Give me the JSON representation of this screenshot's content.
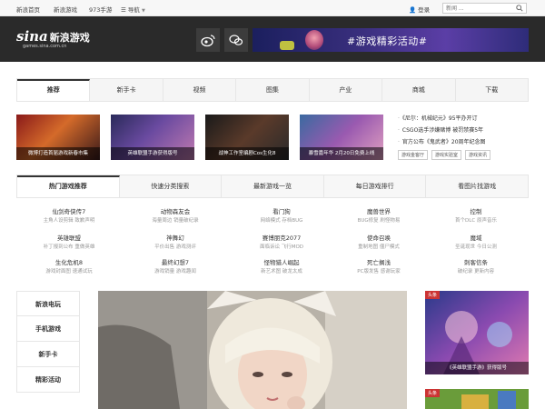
{
  "topbar": {
    "links": [
      "新浪首页",
      "新浪游戏",
      "973手游"
    ],
    "nav_label": "导航",
    "login_label": "登录",
    "search_placeholder": "新闻 ..."
  },
  "header": {
    "logo_brand": "sina",
    "logo_cn": "新浪游戏",
    "logo_url": "games.sina.com.cn",
    "banner_text": "#游戏精彩活动#"
  },
  "tabs1": [
    "推荐",
    "新手卡",
    "视频",
    "图集",
    "产业",
    "商城",
    "下载"
  ],
  "thumbs": [
    "微博打造首届游戏新春市集",
    "英雄联盟手游获得版号",
    "战神工作室编剧Cos生化8",
    "暴雪嘉年华 2月20日免费上线"
  ],
  "news": {
    "items": [
      "《尼尔：机械纪元》95平办开订",
      "CSGO选手涉嫌赌博 被罚禁赛5年",
      "官方公布《鬼武者》20周年纪念图"
    ],
    "chips": [
      "游戏金客厅",
      "游戏实验室",
      "游戏资讯"
    ]
  },
  "tabs2": [
    "热门游戏推荐",
    "快速分类搜索",
    "最新游戏一览",
    "每日游戏排行",
    "看图片找游戏"
  ],
  "games": [
    {
      "name": "仙剑奇侠传7",
      "subs": [
        "主角人设剪辑",
        "致歉声明"
      ]
    },
    {
      "name": "动物森友会",
      "subs": [
        "海量周边",
        "销量破纪录"
      ]
    },
    {
      "name": "看门狗",
      "subs": [
        "网络模式",
        "存档BUG"
      ]
    },
    {
      "name": "魔兽世界",
      "subs": [
        "BUG修复",
        "刷怪物易"
      ]
    },
    {
      "name": "控制",
      "subs": [
        "首个DLC",
        "原声音乐"
      ]
    },
    {
      "name": "英雄联盟",
      "subs": [
        "补丁报到公布",
        "重做英雄"
      ]
    },
    {
      "name": "神舞幻",
      "subs": [
        "平价出售",
        "游戏测评"
      ]
    },
    {
      "name": "赛博朋克2077",
      "subs": [
        "面临诉讼",
        "飞行MOD"
      ]
    },
    {
      "name": "使命召唤",
      "subs": [
        "重制地图",
        "僵尸模式"
      ]
    },
    {
      "name": "魔域",
      "subs": [
        "圣诞现世",
        "今日公测"
      ]
    },
    {
      "name": "生化危机8",
      "subs": [
        "游戏封面图",
        "速通试玩"
      ]
    },
    {
      "name": "最终幻想7",
      "subs": [
        "游戏销量",
        "游戏趣闻"
      ]
    },
    {
      "name": "怪物猎人崛起",
      "subs": [
        "新艺术图",
        "破龙太成"
      ]
    },
    {
      "name": "死亡搁浅",
      "subs": [
        "PC版发售",
        "感谢玩家"
      ]
    },
    {
      "name": "刺客信条",
      "subs": [
        "破纪录",
        "更新内容"
      ]
    }
  ],
  "left_menu": [
    "新浪电玩",
    "手机游戏",
    "新手卡",
    "精彩活动"
  ],
  "side": {
    "tag": "头条",
    "caption": "《英雄联盟手游》获得版号",
    "tag2": "头条"
  },
  "colors": {
    "header_bg": "#2a2a2a",
    "accent_red": "#cc3333"
  }
}
